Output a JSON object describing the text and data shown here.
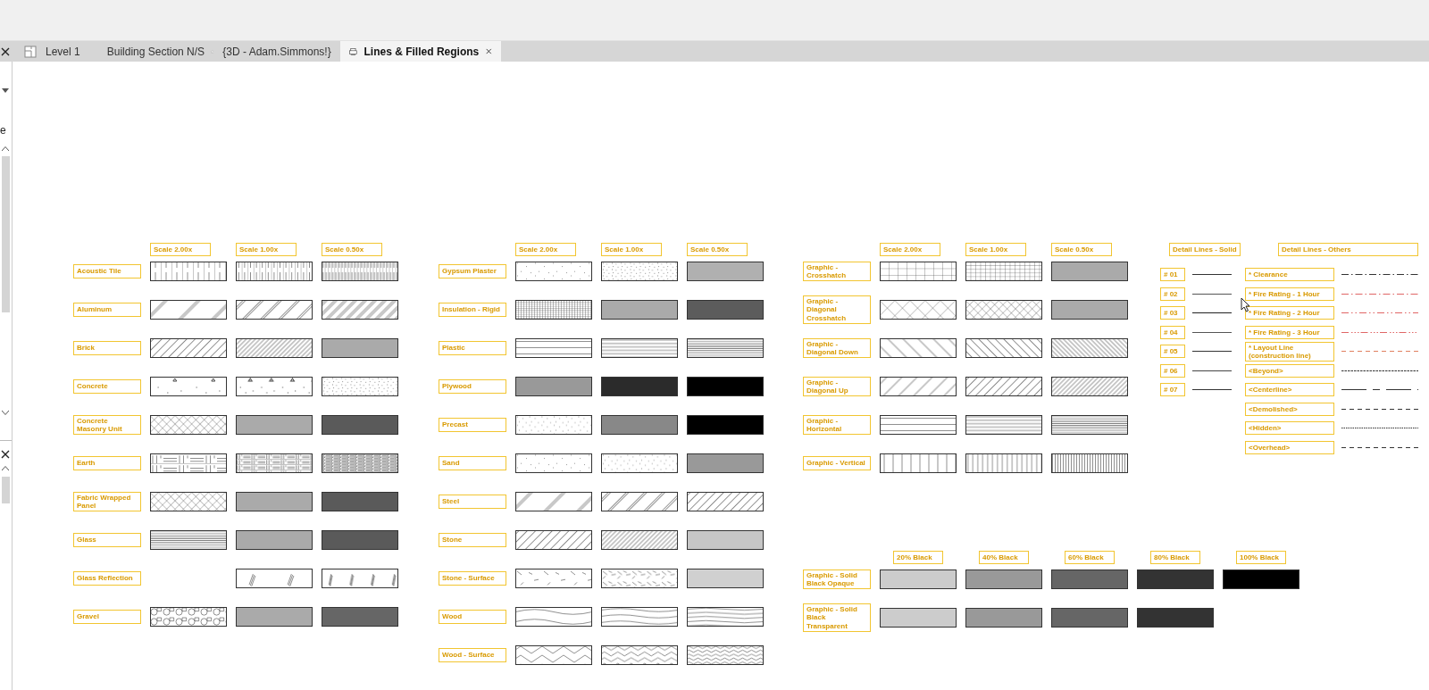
{
  "left_panel": {
    "text": "e"
  },
  "tabs": [
    {
      "label": "Level 1",
      "kind": "plan",
      "selected": false
    },
    {
      "label": "Building Section N/S",
      "kind": "section",
      "selected": false
    },
    {
      "label": "{3D - Adam.Simmons!}",
      "kind": "model",
      "selected": false
    },
    {
      "label": "Lines & Filled Regions",
      "kind": "sheet",
      "selected": true
    }
  ],
  "legends": [
    {
      "headers": [
        "Scale 2.00x",
        "Scale 1.00x",
        "Scale 0.50x"
      ],
      "rows": [
        {
          "label": "Acoustic Tile",
          "swatches": [
            {
              "kind": "tiles-wide"
            },
            {
              "kind": "tiles-medium"
            },
            {
              "kind": "tiles-fine"
            }
          ]
        },
        {
          "label": "Aluminum",
          "swatches": [
            {
              "kind": "diag-double-wide"
            },
            {
              "kind": "diag-double-medium"
            },
            {
              "kind": "diag-double-fine"
            }
          ]
        },
        {
          "label": "Brick",
          "swatches": [
            {
              "kind": "diag-up-medium"
            },
            {
              "kind": "diag-up-fine"
            },
            {
              "kind": "solid",
              "color": "#aaaaaa"
            }
          ]
        },
        {
          "label": "Concrete",
          "swatches": [
            {
              "kind": "concrete-wide"
            },
            {
              "kind": "concrete-medium"
            },
            {
              "kind": "dots-fine"
            }
          ]
        },
        {
          "label": "Concrete Masonry Unit",
          "swatches": [
            {
              "kind": "cross-diag-medium"
            },
            {
              "kind": "solid",
              "color": "#aaaaaa"
            },
            {
              "kind": "solid",
              "color": "#5a5a5a"
            }
          ]
        },
        {
          "label": "Earth",
          "swatches": [
            {
              "kind": "weave-wide"
            },
            {
              "kind": "weave-medium"
            },
            {
              "kind": "weave-fine"
            }
          ]
        },
        {
          "label": "Fabric Wrapped Panel",
          "swatches": [
            {
              "kind": "cross-diag-medium"
            },
            {
              "kind": "solid",
              "color": "#aaaaaa"
            },
            {
              "kind": "solid",
              "color": "#5a5a5a"
            }
          ]
        },
        {
          "label": "Glass",
          "swatches": [
            {
              "kind": "horizontal-fine"
            },
            {
              "kind": "solid",
              "color": "#aaaaaa"
            },
            {
              "kind": "solid",
              "color": "#5a5a5a"
            }
          ]
        },
        {
          "label": "Glass Reflection",
          "swatches": [
            {
              "kind": "none"
            },
            {
              "kind": "reflection-wide"
            },
            {
              "kind": "reflection-medium"
            }
          ]
        },
        {
          "label": "Gravel",
          "swatches": [
            {
              "kind": "stones-wide"
            },
            {
              "kind": "solid",
              "color": "#aaaaaa"
            },
            {
              "kind": "solid",
              "color": "#666666"
            }
          ]
        }
      ]
    },
    {
      "headers": [
        "Scale 2.00x",
        "Scale 1.00x",
        "Scale 0.50x"
      ],
      "rows": [
        {
          "label": "Gypsum Plaster",
          "swatches": [
            {
              "kind": "dots-wide"
            },
            {
              "kind": "dots-fine"
            },
            {
              "kind": "solid",
              "color": "#b0b0b0"
            }
          ]
        },
        {
          "label": "Insulation - Rigid",
          "swatches": [
            {
              "kind": "grid-fine"
            },
            {
              "kind": "solid",
              "color": "#aaaaaa"
            },
            {
              "kind": "solid",
              "color": "#5c5c5c"
            }
          ]
        },
        {
          "label": "Plastic",
          "swatches": [
            {
              "kind": "horizontal-wide"
            },
            {
              "kind": "horizontal-medium"
            },
            {
              "kind": "horizontal-fine"
            }
          ]
        },
        {
          "label": "Plywood",
          "swatches": [
            {
              "kind": "solid",
              "color": "#999999"
            },
            {
              "kind": "solid",
              "color": "#2b2b2b"
            },
            {
              "kind": "solid",
              "color": "#000000"
            }
          ]
        },
        {
          "label": "Precast",
          "swatches": [
            {
              "kind": "dots-medium"
            },
            {
              "kind": "solid",
              "color": "#888888"
            },
            {
              "kind": "solid",
              "color": "#000000"
            }
          ]
        },
        {
          "label": "Sand",
          "swatches": [
            {
              "kind": "dots-wide"
            },
            {
              "kind": "dots-medium"
            },
            {
              "kind": "solid",
              "color": "#999999"
            }
          ]
        },
        {
          "label": "Steel",
          "swatches": [
            {
              "kind": "diag-double-wide"
            },
            {
              "kind": "diag-double-medium"
            },
            {
              "kind": "diag-up-medium"
            }
          ]
        },
        {
          "label": "Stone",
          "swatches": [
            {
              "kind": "diag-up-medium"
            },
            {
              "kind": "diag-up-fine"
            },
            {
              "kind": "solid",
              "color": "#c6c6c6"
            }
          ]
        },
        {
          "label": "Stone - Surface",
          "swatches": [
            {
              "kind": "stone-surface-wide"
            },
            {
              "kind": "stone-surface-medium"
            },
            {
              "kind": "solid",
              "color": "#d0d0d0"
            }
          ]
        },
        {
          "label": "Wood",
          "swatches": [
            {
              "kind": "wood-wide"
            },
            {
              "kind": "wood-medium"
            },
            {
              "kind": "wood-fine"
            }
          ]
        },
        {
          "label": "Wood - Surface",
          "swatches": [
            {
              "kind": "wood-surface-wide"
            },
            {
              "kind": "wood-surface-medium"
            },
            {
              "kind": "wood-surface-fine"
            }
          ]
        }
      ]
    },
    {
      "headers": [
        "Scale 2.00x",
        "Scale 1.00x",
        "Scale 0.50x"
      ],
      "rows": [
        {
          "label": "Graphic - Crosshatch",
          "swatches": [
            {
              "kind": "grid-wide"
            },
            {
              "kind": "grid-medium"
            },
            {
              "kind": "solid",
              "color": "#aaaaaa"
            }
          ]
        },
        {
          "label": "Graphic - Diagonal Crosshatch",
          "swatches": [
            {
              "kind": "cross-diag-wide"
            },
            {
              "kind": "cross-diag-medium"
            },
            {
              "kind": "solid",
              "color": "#aaaaaa"
            }
          ]
        },
        {
          "label": "Graphic - Diagonal Down",
          "swatches": [
            {
              "kind": "diag-down-wide"
            },
            {
              "kind": "diag-down-medium"
            },
            {
              "kind": "diag-down-fine"
            }
          ]
        },
        {
          "label": "Graphic - Diagonal Up",
          "swatches": [
            {
              "kind": "diag-up-wide"
            },
            {
              "kind": "diag-up-medium"
            },
            {
              "kind": "diag-up-fine"
            }
          ]
        },
        {
          "label": "Graphic - Horizontal",
          "swatches": [
            {
              "kind": "horizontal-wide"
            },
            {
              "kind": "horizontal-medium"
            },
            {
              "kind": "horizontal-fine"
            }
          ]
        },
        {
          "label": "Graphic - Vertical",
          "swatches": [
            {
              "kind": "vertical-wide"
            },
            {
              "kind": "vertical-medium"
            },
            {
              "kind": "vertical-fine"
            }
          ]
        }
      ]
    },
    {
      "headers": [
        "20% Black",
        "40% Black",
        "60% Black",
        "80% Black",
        "100% Black"
      ],
      "rows": [
        {
          "label": "Graphic - Solid Black Opaque",
          "swatches": [
            {
              "kind": "solid",
              "color": "#cccccc"
            },
            {
              "kind": "solid",
              "color": "#999999"
            },
            {
              "kind": "solid",
              "color": "#666666"
            },
            {
              "kind": "solid",
              "color": "#333333"
            },
            {
              "kind": "solid",
              "color": "#000000"
            }
          ]
        },
        {
          "label": "Graphic - Solid Black Transparent",
          "swatches": [
            {
              "kind": "solid",
              "color": "#cccccc"
            },
            {
              "kind": "solid",
              "color": "#999999"
            },
            {
              "kind": "solid",
              "color": "#666666"
            },
            {
              "kind": "solid",
              "color": "#333333"
            }
          ]
        }
      ]
    }
  ],
  "detail_lines": [
    {
      "header": "Detail Lines - Solid",
      "rows": [
        {
          "label": "# 01",
          "kind": "solid",
          "color": "#333333"
        },
        {
          "label": "# 02",
          "kind": "solid",
          "color": "#555555"
        },
        {
          "label": "# 03",
          "kind": "solid",
          "color": "#222222"
        },
        {
          "label": "# 04",
          "kind": "solid",
          "color": "#555555"
        },
        {
          "label": "# 05",
          "kind": "solid",
          "color": "#333333"
        },
        {
          "label": "# 06",
          "kind": "solid",
          "color": "#444444"
        },
        {
          "label": "# 07",
          "kind": "solid",
          "color": "#333333"
        }
      ]
    },
    {
      "header": "Detail Lines - Others",
      "rows": [
        {
          "label": "* Clearance",
          "kind": "dash-dot",
          "color": "#333333"
        },
        {
          "label": "* Fire Rating - 1 Hour",
          "kind": "dash-dot",
          "color": "#e06666"
        },
        {
          "label": "* Fire Rating - 2 Hour",
          "kind": "dash-dot-dot",
          "color": "#e06666"
        },
        {
          "label": "* Fire Rating - 3 Hour",
          "kind": "dash-dot-dot-dot",
          "color": "#e06666"
        },
        {
          "label": "* Layout Line (construction line)",
          "kind": "dashed",
          "color": "#e08060"
        },
        {
          "label": "<Beyond>",
          "kind": "fine-dashed",
          "color": "#333333"
        },
        {
          "label": "<Centerline>",
          "kind": "centerline",
          "color": "#333333"
        },
        {
          "label": "<Demolished>",
          "kind": "dashed",
          "color": "#333333"
        },
        {
          "label": "<Hidden>",
          "kind": "dotted",
          "color": "#333333"
        },
        {
          "label": "<Overhead>",
          "kind": "dashed",
          "color": "#333333"
        }
      ]
    }
  ]
}
